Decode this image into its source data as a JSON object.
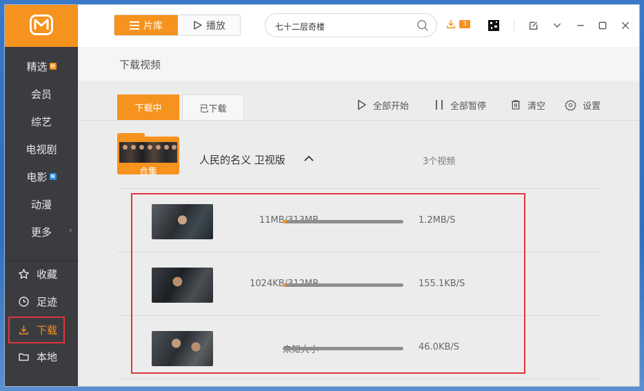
{
  "sidebar": {
    "logo": "mgtv-logo-icon",
    "items": [
      {
        "label": "精选",
        "badge": "H",
        "badge_color": "#f6921e"
      },
      {
        "label": "会员"
      },
      {
        "label": "综艺"
      },
      {
        "label": "电视剧"
      },
      {
        "label": "电影",
        "badge": "N",
        "badge_color": "#2f8de0"
      },
      {
        "label": "动漫"
      },
      {
        "label": "更多"
      }
    ],
    "bottom": [
      {
        "label": "收藏",
        "icon": "star-icon"
      },
      {
        "label": "足迹",
        "icon": "clock-icon"
      },
      {
        "label": "下载",
        "icon": "download-icon",
        "active": true
      },
      {
        "label": "本地",
        "icon": "folder-icon"
      }
    ]
  },
  "topbar": {
    "segment_library": "片库",
    "segment_play": "播放",
    "search_value": "七十二层奇楼",
    "download_count": "3"
  },
  "page_title": "下载视频",
  "tabs": {
    "downloading": "下载中",
    "downloaded": "已下载"
  },
  "actions": {
    "start_all": "全部开始",
    "pause_all": "全部暂停",
    "clear": "清空",
    "settings": "设置"
  },
  "group": {
    "folder_label": "合集",
    "title": "人民的名义 卫视版",
    "count": "3个视频"
  },
  "downloads": [
    {
      "size": "11MB/313MB",
      "progress": 0.035,
      "speed": "1.2MB/S"
    },
    {
      "size": "1024KB/312MB",
      "progress": 0.003,
      "speed": "155.1KB/S"
    },
    {
      "size": "未知大小",
      "progress": 0,
      "speed": "46.0KB/S"
    }
  ],
  "colors": {
    "accent": "#f6921e",
    "sidebar_bg": "#3b3c40",
    "highlight": "#e0353c"
  }
}
